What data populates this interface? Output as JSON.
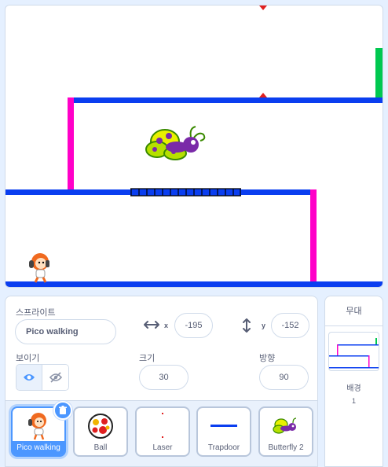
{
  "sprite_info": {
    "section_label": "스프라이트",
    "sprite_name": "Pico walking",
    "x_label": "x",
    "x_value": "-195",
    "y_label": "y",
    "y_value": "-152",
    "show_label": "보이기",
    "size_label": "크기",
    "size_value": "30",
    "direction_label": "방향",
    "direction_value": "90"
  },
  "sprites": [
    {
      "name": "Pico walking",
      "selected": true,
      "icon": "pico-icon"
    },
    {
      "name": "Ball",
      "selected": false,
      "icon": "ball-icon"
    },
    {
      "name": "Laser",
      "selected": false,
      "icon": "laser-icon"
    },
    {
      "name": "Trapdoor",
      "selected": false,
      "icon": "trapdoor-icon"
    },
    {
      "name": "Butterfly 2",
      "selected": false,
      "icon": "butterfly-icon"
    }
  ],
  "stage_panel": {
    "title": "무대",
    "backdrop_label": "배경",
    "backdrop_count": "1"
  },
  "colors": {
    "platform_blue": "#0a3ef0",
    "wall_magenta": "#ff00c8",
    "goal_green": "#00c850",
    "laser_red": "#e02020",
    "accent": "#4c97ff"
  }
}
